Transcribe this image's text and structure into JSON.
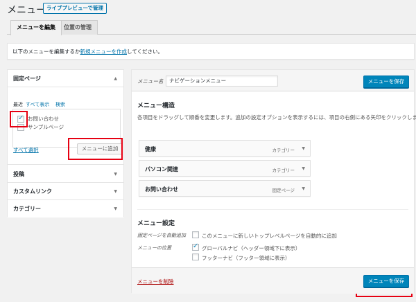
{
  "header": {
    "title": "メニュー",
    "live_preview_label": "ライブプレビューで管理"
  },
  "tabs": {
    "edit": "メニューを編集",
    "locations": "位置の管理"
  },
  "manage": {
    "before": "以下のメニューを編集するか",
    "link": "新規メニューを作成",
    "after": "してください。"
  },
  "left": {
    "pages": {
      "heading": "固定ページ",
      "tabs": [
        "最近",
        "すべて表示",
        "検索"
      ],
      "items": [
        {
          "label": "お問い合わせ",
          "checked": true
        },
        {
          "label": "サンプルページ",
          "checked": false
        }
      ],
      "select_all": "すべて選択",
      "add_button": "メニューに追加"
    },
    "posts": "投稿",
    "custom_links": "カスタムリンク",
    "categories": "カテゴリー"
  },
  "right": {
    "menu_name_label": "メニュー名",
    "menu_name_value": "ナビゲーションメニュー",
    "save_label": "メニューを保存",
    "structure_title": "メニュー構造",
    "structure_desc": "各項目をドラッグして順番を変更します。追加の設定オプションを表示するには、項目の右側にある矢印をクリックします。",
    "menu_items": [
      {
        "title": "健康",
        "type": "カテゴリー"
      },
      {
        "title": "パソコン関連",
        "type": "カテゴリー"
      },
      {
        "title": "お問い合わせ",
        "type": "固定ページ"
      }
    ],
    "settings_title": "メニュー設定",
    "auto_add_label": "固定ページを自動追加",
    "auto_add_text": "このメニューに新しいトップレベルページを自動的に追加",
    "auto_add_checked": false,
    "location_label": "メニューの位置",
    "locations": [
      {
        "label": "グローバルナビ（ヘッダー領域下に表示）",
        "checked": true
      },
      {
        "label": "フッターナビ（フッター領域に表示）",
        "checked": false
      }
    ],
    "delete_label": "メニューを削除"
  },
  "colors": {
    "primary": "#0085ba",
    "link": "#0073aa",
    "highlight": "#e60012",
    "delete": "#aa0000"
  }
}
